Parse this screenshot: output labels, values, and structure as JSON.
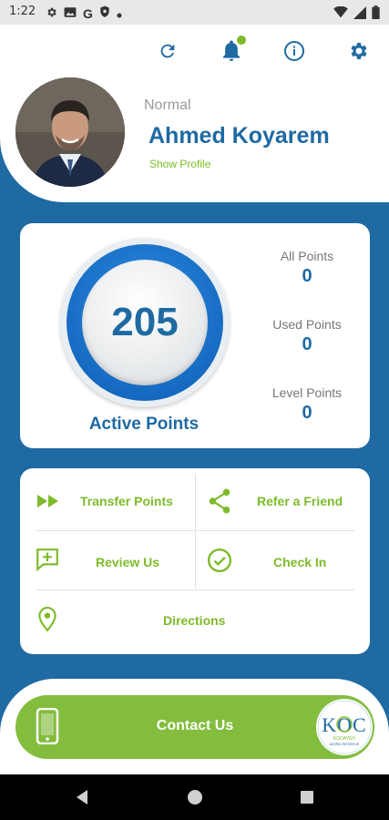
{
  "status_bar": {
    "time": "1:22",
    "left_icons": [
      "gear-icon",
      "image-icon",
      "google-icon",
      "shield-icon",
      "dot-icon"
    ],
    "right_icons": [
      "wifi-icon",
      "signal-icon",
      "battery-icon"
    ]
  },
  "header": {
    "icons": [
      "refresh-icon",
      "bell-icon",
      "info-icon",
      "settings-icon"
    ],
    "notification_dot_color": "#7dbb2a",
    "user": {
      "level": "Normal",
      "name": "Ahmed Koyarem",
      "show_profile": "Show Profile"
    }
  },
  "points": {
    "active_value": "205",
    "active_label": "Active Points",
    "stats": [
      {
        "label": "All Points",
        "value": "0"
      },
      {
        "label": "Used Points",
        "value": "0"
      },
      {
        "label": "Level Points",
        "value": "0"
      }
    ]
  },
  "actions": [
    {
      "label": "Transfer Points",
      "icon": "fast-forward-icon"
    },
    {
      "label": "Refer a Friend",
      "icon": "share-icon"
    },
    {
      "label": "Review Us",
      "icon": "review-icon"
    },
    {
      "label": "Check In",
      "icon": "check-circle-icon"
    },
    {
      "label": "Directions",
      "icon": "location-pin-icon"
    }
  ],
  "contact": {
    "label": "Contact Us",
    "icon": "phone-icon",
    "logo_text": "KOC",
    "logo_sub": "KODAYEH",
    "logo_sub2": "WORD RESERVE"
  },
  "nav": [
    "back-icon",
    "home-icon",
    "recents-icon"
  ],
  "colors": {
    "brand_blue": "#1f6aa3",
    "accent_green": "#7dbb2a",
    "contact_green": "#83bd3e"
  }
}
